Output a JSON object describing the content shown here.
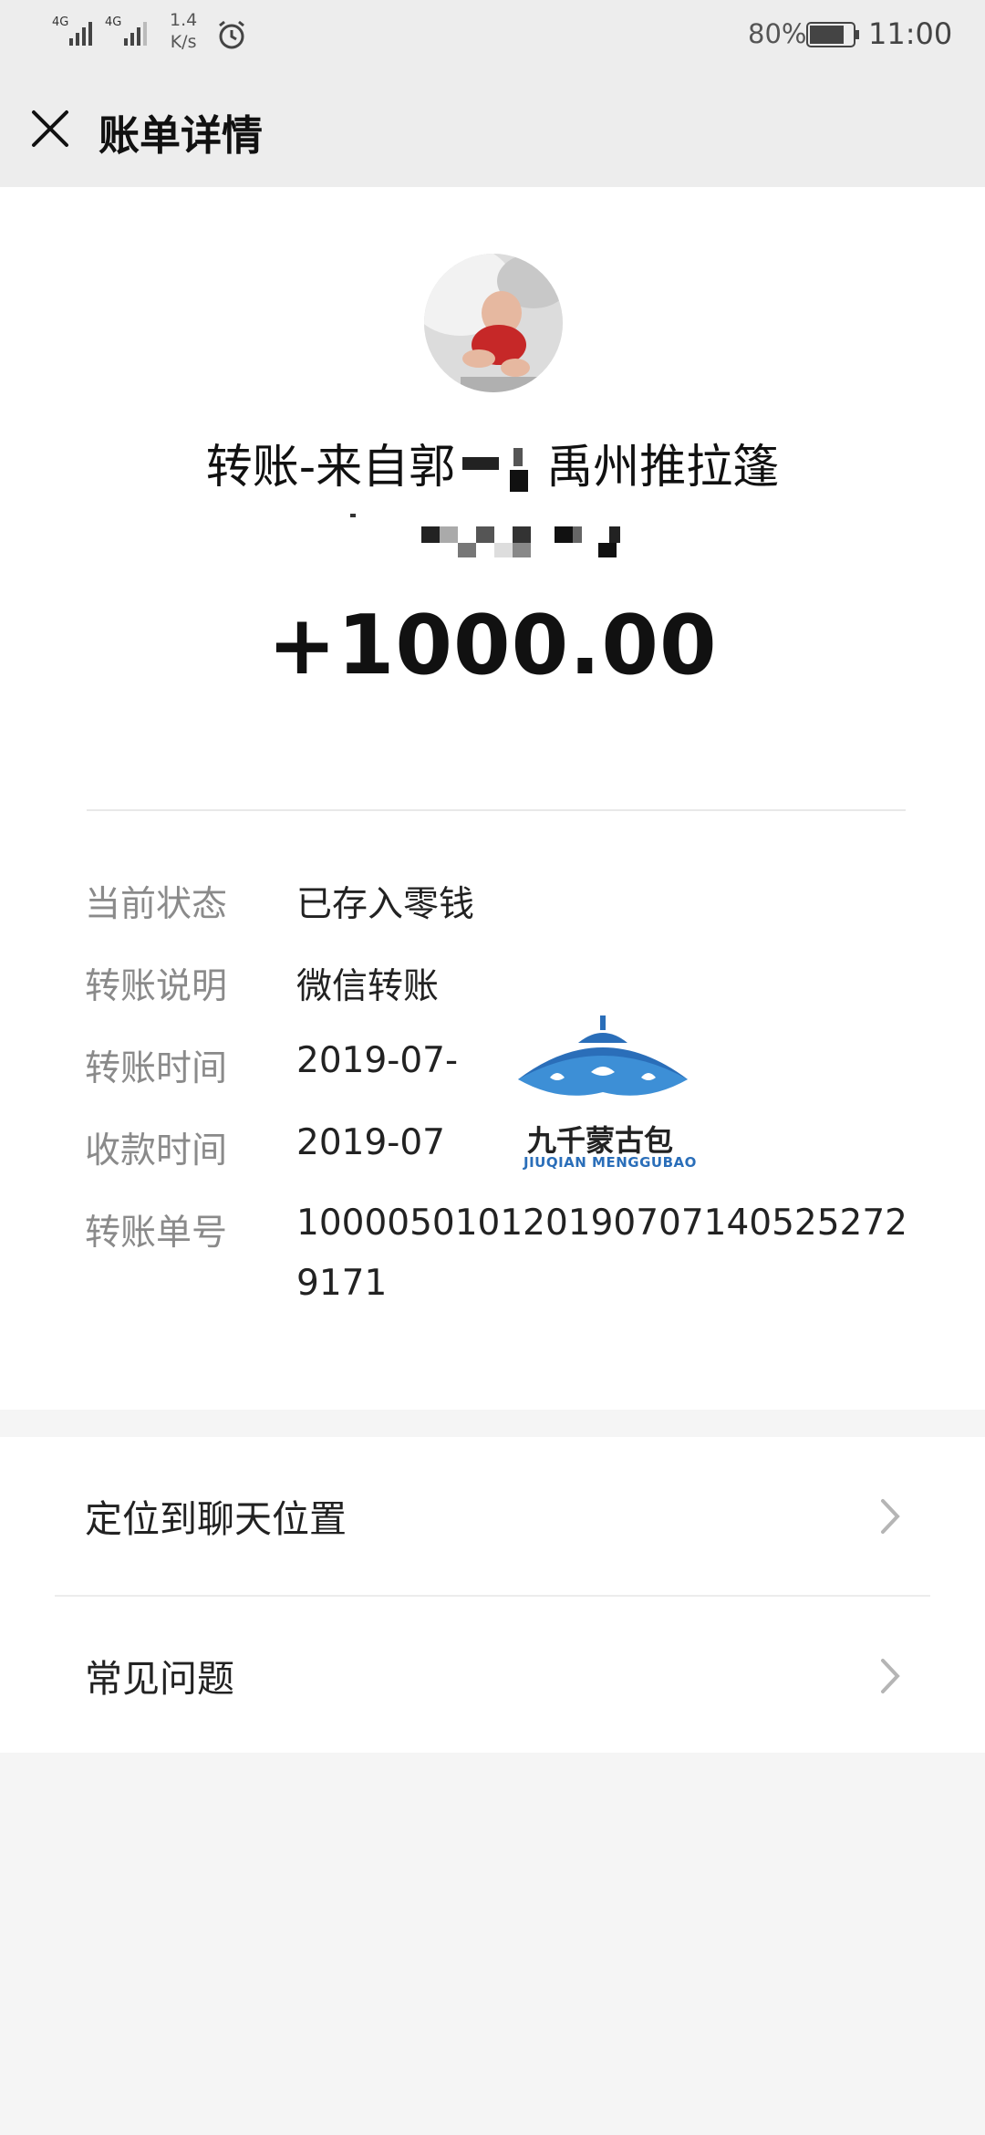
{
  "status_bar": {
    "net1": "4G",
    "net2": "4G",
    "speed_value": "1.4",
    "speed_unit": "K/s",
    "battery_percent": "80%",
    "battery_level": 0.8,
    "time": "11:00"
  },
  "header": {
    "title": "账单详情"
  },
  "transfer": {
    "payer_prefix": "转账-来自郭",
    "payer_suffix": "禹州推拉篷",
    "amount": "+1000.00"
  },
  "details": [
    {
      "label": "当前状态",
      "value": "已存入零钱"
    },
    {
      "label": "转账说明",
      "value": "微信转账"
    },
    {
      "label": "转账时间",
      "value": "2019-07-"
    },
    {
      "label": "收款时间",
      "value": "2019-07"
    },
    {
      "label": "转账单号",
      "value": "1000050101201907071405252729171"
    }
  ],
  "watermark": {
    "text": "九千蒙古包",
    "subtext": "JIUQIAN MENGGUBAO"
  },
  "menu": [
    {
      "label": "定位到聊天位置"
    },
    {
      "label": "常见问题"
    }
  ],
  "colors": {
    "background": "#f5f5f5",
    "header_bg": "#ededed",
    "card_bg": "#ffffff",
    "label_gray": "#8a8a8a",
    "watermark_blue": "#2a6eb9"
  }
}
